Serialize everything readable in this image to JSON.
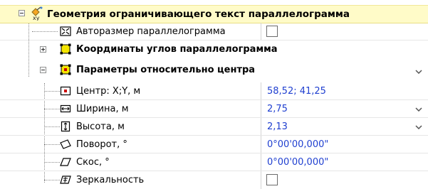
{
  "rows": [
    {
      "label": "Геометрия ограничивающего текст параллелограмма",
      "icon": "geometry-xy-icon"
    },
    {
      "label": "Авторазмер параллелограмма",
      "icon": "autosize-icon",
      "checked": false
    },
    {
      "label": "Координаты углов параллелограмма",
      "icon": "corners-icon"
    },
    {
      "label": "Параметры относительно центра",
      "icon": "center-params-icon"
    },
    {
      "label": "Центр: X;Y, м",
      "value": "58,52; 41,25",
      "icon": "center-icon"
    },
    {
      "label": "Ширина, м",
      "value": "2,75",
      "icon": "width-icon"
    },
    {
      "label": "Высота, м",
      "value": "2,13",
      "icon": "height-icon"
    },
    {
      "label": "Поворот, °",
      "value": "0°00'00,000\"",
      "icon": "rotation-icon"
    },
    {
      "label": "Скос, °",
      "value": "0°00'00,000\"",
      "icon": "skew-icon"
    },
    {
      "label": "Зеркальность",
      "icon": "mirror-icon",
      "checked": false
    }
  ],
  "colors": {
    "header_bg": "#fffbc8",
    "value_text": "#1f3fd0",
    "icon_yellow": "#f5e600"
  }
}
